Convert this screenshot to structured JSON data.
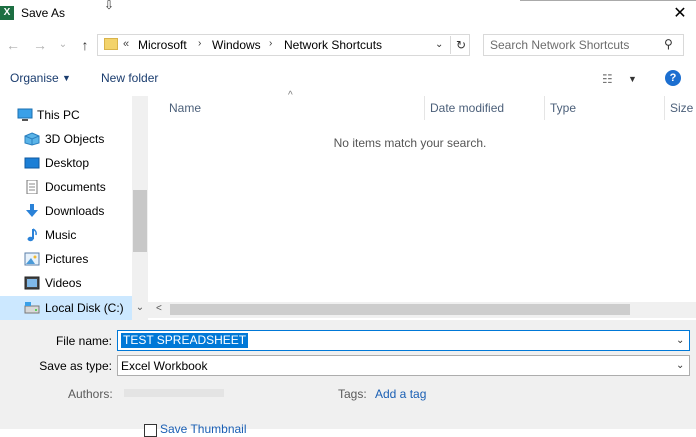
{
  "window": {
    "title": "Save As",
    "app_icon": "X",
    "close_glyph": "✕",
    "cursor_glyph": "⇩"
  },
  "nav": {
    "back_glyph": "←",
    "forward_glyph": "→",
    "history_glyph": "⌄",
    "up_glyph": "↑"
  },
  "address": {
    "lead": "«",
    "crumbs": [
      "Microsoft",
      "Windows",
      "Network Shortcuts"
    ],
    "sep": "›",
    "dropdown": "⌄",
    "refresh": "↻"
  },
  "search": {
    "placeholder": "Search Network Shortcuts",
    "icon": "⚲"
  },
  "toolbar": {
    "organise": "Organise",
    "organise_caret": "▼",
    "new_folder": "New folder",
    "view_icon": "☷",
    "view_caret": "▼",
    "help": "?"
  },
  "sidebar": {
    "items": [
      {
        "label": "This PC",
        "icon": "pc-icon"
      },
      {
        "label": "3D Objects",
        "icon": "cube-icon"
      },
      {
        "label": "Desktop",
        "icon": "desktop-icon"
      },
      {
        "label": "Documents",
        "icon": "document-icon"
      },
      {
        "label": "Downloads",
        "icon": "download-icon"
      },
      {
        "label": "Music",
        "icon": "music-icon"
      },
      {
        "label": "Pictures",
        "icon": "picture-icon"
      },
      {
        "label": "Videos",
        "icon": "video-icon"
      },
      {
        "label": "Local Disk (C:)",
        "icon": "drive-icon"
      }
    ],
    "scroll_down": "⌄"
  },
  "columns": {
    "name": "Name",
    "date_modified": "Date modified",
    "type": "Type",
    "size": "Size",
    "sort_caret": "^"
  },
  "content": {
    "empty_message": "No items match your search."
  },
  "hscroll": {
    "left": "<"
  },
  "form": {
    "file_name_label": "File name:",
    "file_name_value": "TEST SPREADSHEET",
    "save_as_type_label": "Save as type:",
    "save_as_type_value": "Excel Workbook",
    "dropdown_caret": "⌄",
    "authors_label": "Authors:",
    "tags_label": "Tags:",
    "add_tag": "Add a tag",
    "save_thumbnail": "Save Thumbnail"
  },
  "colors": {
    "accent": "#0078d7",
    "selected_nav": "#cce8ff",
    "link": "#1a5fb4",
    "excel_green": "#1d6f42"
  }
}
